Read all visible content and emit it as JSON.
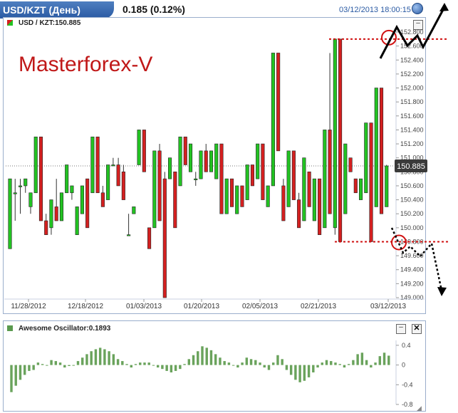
{
  "header": {
    "title": "USD/KZT (День)",
    "quote": "0.185 (0.12%)",
    "timestamp": "03/12/2013 18:00:15"
  },
  "main_panel": {
    "legend": "USD / KZT:150.885",
    "minimize_label": "–",
    "watermark": "Masterforex-V",
    "last_price_label": "150.885"
  },
  "oscillator_panel": {
    "legend": "Awesome Oscillator:0.1893",
    "minimize_label": "–",
    "close_label": "✕",
    "resize_icon": "resize-grip-icon"
  },
  "colors": {
    "up": "#22c322",
    "down": "#d42020",
    "oscillator": "#6aa35c",
    "annotation": "#d01010"
  },
  "chart_data": [
    {
      "type": "candlestick",
      "title": "USD / KZT",
      "ylim": [
        149.0,
        152.8
      ],
      "yticks": [
        149.0,
        149.2,
        149.4,
        149.6,
        149.8,
        150.0,
        150.2,
        150.4,
        150.6,
        150.8,
        151.0,
        151.2,
        151.4,
        151.6,
        151.8,
        152.0,
        152.2,
        152.4,
        152.6,
        152.8
      ],
      "ytick_labels": [
        "149.000",
        "149.200",
        "149.400",
        "149.600",
        "149.800",
        "150.000",
        "150.200",
        "150.400",
        "150.600",
        "150.800",
        "151.000",
        "151.200",
        "151.400",
        "151.600",
        "151.800",
        "152.000",
        "152.200",
        "152.400",
        "152.600",
        "152.800"
      ],
      "xtick_labels": [
        "11/28/2012",
        "12/18/2012",
        "01/03/2013",
        "01/20/2013",
        "02/05/2013",
        "02/21/2013",
        "03/12/2013"
      ],
      "last_value": 150.885,
      "annotations": {
        "resistance": 152.7,
        "support": 149.8
      },
      "candles": [
        {
          "o": 149.7,
          "h": 150.7,
          "l": 149.7,
          "c": 150.7
        },
        {
          "o": 150.5,
          "h": 150.7,
          "l": 150.1,
          "c": 150.5
        },
        {
          "o": 150.6,
          "h": 150.7,
          "l": 150.2,
          "c": 150.6
        },
        {
          "o": 150.6,
          "h": 150.7,
          "l": 150.5,
          "c": 150.7
        },
        {
          "o": 150.3,
          "h": 150.3,
          "l": 150.2,
          "c": 150.5
        },
        {
          "o": 150.5,
          "h": 151.3,
          "l": 150.5,
          "c": 151.3
        },
        {
          "o": 151.3,
          "h": 151.3,
          "l": 150.1,
          "c": 150.1
        },
        {
          "o": 150.1,
          "h": 150.2,
          "l": 149.9,
          "c": 149.9
        },
        {
          "o": 150.0,
          "h": 150.4,
          "l": 149.9,
          "c": 150.4
        },
        {
          "o": 150.3,
          "h": 150.7,
          "l": 150.1,
          "c": 150.1
        },
        {
          "o": 150.1,
          "h": 150.5,
          "l": 150.1,
          "c": 150.5
        },
        {
          "o": 150.5,
          "h": 150.9,
          "l": 150.5,
          "c": 150.9
        },
        {
          "o": 150.5,
          "h": 150.6,
          "l": 150.4,
          "c": 150.6
        },
        {
          "o": 149.9,
          "h": 150.3,
          "l": 149.9,
          "c": 150.3
        },
        {
          "o": 150.2,
          "h": 150.6,
          "l": 150.2,
          "c": 150.6
        },
        {
          "o": 150.7,
          "h": 150.7,
          "l": 150.0,
          "c": 150.0
        },
        {
          "o": 150.5,
          "h": 151.3,
          "l": 150.5,
          "c": 151.3
        },
        {
          "o": 151.3,
          "h": 151.3,
          "l": 150.5,
          "c": 150.5
        },
        {
          "o": 150.5,
          "h": 150.6,
          "l": 150.3,
          "c": 150.3
        },
        {
          "o": 150.4,
          "h": 150.9,
          "l": 150.4,
          "c": 150.9
        },
        {
          "o": 150.9,
          "h": 151.0,
          "l": 150.9,
          "c": 150.9
        },
        {
          "o": 150.9,
          "h": 151.0,
          "l": 150.6,
          "c": 150.6
        },
        {
          "o": 150.8,
          "h": 150.9,
          "l": 150.4,
          "c": 150.4
        },
        {
          "o": 149.9,
          "h": 150.2,
          "l": 149.9,
          "c": 149.9
        },
        {
          "o": 150.2,
          "h": 150.3,
          "l": 150.2,
          "c": 150.3
        },
        {
          "o": 150.9,
          "h": 151.4,
          "l": 150.9,
          "c": 151.4
        },
        {
          "o": 151.4,
          "h": 151.4,
          "l": 150.8,
          "c": 150.8
        },
        {
          "o": 150.0,
          "h": 150.0,
          "l": 149.7,
          "c": 149.7
        },
        {
          "o": 150.0,
          "h": 151.1,
          "l": 150.0,
          "c": 151.1
        },
        {
          "o": 151.1,
          "h": 151.2,
          "l": 150.1,
          "c": 150.1
        },
        {
          "o": 150.7,
          "h": 150.8,
          "l": 149.0,
          "c": 149.0
        },
        {
          "o": 150.7,
          "h": 151.0,
          "l": 150.7,
          "c": 151.0
        },
        {
          "o": 150.8,
          "h": 150.8,
          "l": 150.0,
          "c": 150.0
        },
        {
          "o": 150.6,
          "h": 151.3,
          "l": 150.6,
          "c": 151.3
        },
        {
          "o": 151.3,
          "h": 151.3,
          "l": 150.9,
          "c": 150.9
        },
        {
          "o": 150.8,
          "h": 151.2,
          "l": 150.8,
          "c": 151.2
        },
        {
          "o": 150.7,
          "h": 150.8,
          "l": 150.6,
          "c": 150.7
        },
        {
          "o": 150.7,
          "h": 151.1,
          "l": 150.7,
          "c": 151.1
        },
        {
          "o": 151.1,
          "h": 151.2,
          "l": 150.8,
          "c": 150.8
        },
        {
          "o": 150.8,
          "h": 151.1,
          "l": 150.8,
          "c": 151.1
        },
        {
          "o": 150.7,
          "h": 151.2,
          "l": 150.7,
          "c": 151.2
        },
        {
          "o": 151.2,
          "h": 151.2,
          "l": 150.2,
          "c": 150.2
        },
        {
          "o": 150.2,
          "h": 150.7,
          "l": 150.2,
          "c": 150.7
        },
        {
          "o": 150.7,
          "h": 150.7,
          "l": 150.3,
          "c": 150.3
        },
        {
          "o": 150.2,
          "h": 150.6,
          "l": 150.2,
          "c": 150.6
        },
        {
          "o": 150.6,
          "h": 150.6,
          "l": 150.3,
          "c": 150.3
        },
        {
          "o": 150.4,
          "h": 150.9,
          "l": 150.4,
          "c": 150.9
        },
        {
          "o": 150.9,
          "h": 150.9,
          "l": 150.6,
          "c": 150.6
        },
        {
          "o": 150.7,
          "h": 151.2,
          "l": 150.7,
          "c": 151.2
        },
        {
          "o": 151.2,
          "h": 151.2,
          "l": 150.4,
          "c": 150.4
        },
        {
          "o": 150.3,
          "h": 150.6,
          "l": 150.3,
          "c": 150.6
        },
        {
          "o": 150.6,
          "h": 152.5,
          "l": 150.6,
          "c": 152.5
        },
        {
          "o": 152.5,
          "h": 152.5,
          "l": 151.1,
          "c": 151.1
        },
        {
          "o": 150.6,
          "h": 150.7,
          "l": 150.1,
          "c": 150.1
        },
        {
          "o": 150.3,
          "h": 151.1,
          "l": 150.3,
          "c": 151.1
        },
        {
          "o": 151.1,
          "h": 151.1,
          "l": 150.4,
          "c": 150.4
        },
        {
          "o": 150.4,
          "h": 150.5,
          "l": 150.0,
          "c": 150.0
        },
        {
          "o": 150.1,
          "h": 151.0,
          "l": 150.1,
          "c": 151.0
        },
        {
          "o": 150.8,
          "h": 150.8,
          "l": 150.3,
          "c": 150.3
        },
        {
          "o": 150.1,
          "h": 150.7,
          "l": 150.1,
          "c": 150.7
        },
        {
          "o": 150.7,
          "h": 150.7,
          "l": 149.9,
          "c": 149.9
        },
        {
          "o": 150.0,
          "h": 151.4,
          "l": 150.0,
          "c": 151.4
        },
        {
          "o": 151.4,
          "h": 152.5,
          "l": 150.2,
          "c": 150.2
        },
        {
          "o": 150.0,
          "h": 152.7,
          "l": 149.9,
          "c": 152.7
        },
        {
          "o": 152.7,
          "h": 152.7,
          "l": 149.8,
          "c": 149.8
        },
        {
          "o": 150.2,
          "h": 151.2,
          "l": 150.2,
          "c": 151.2
        },
        {
          "o": 151.0,
          "h": 151.0,
          "l": 150.8,
          "c": 150.8
        },
        {
          "o": 150.7,
          "h": 150.7,
          "l": 150.5,
          "c": 150.5
        },
        {
          "o": 150.4,
          "h": 150.7,
          "l": 150.4,
          "c": 150.7
        },
        {
          "o": 150.5,
          "h": 151.5,
          "l": 150.5,
          "c": 151.5
        },
        {
          "o": 151.5,
          "h": 151.5,
          "l": 149.8,
          "c": 149.8
        },
        {
          "o": 150.3,
          "h": 152.0,
          "l": 150.3,
          "c": 152.0
        },
        {
          "o": 152.0,
          "h": 152.0,
          "l": 150.2,
          "c": 150.2
        },
        {
          "o": 150.3,
          "h": 150.9,
          "l": 150.3,
          "c": 150.885
        }
      ]
    },
    {
      "type": "bar",
      "title": "Awesome Oscillator",
      "last_value": 0.1893,
      "ylim": [
        -0.8,
        0.5
      ],
      "yticks": [
        0.4,
        0,
        -0.4,
        -0.8
      ],
      "ytick_labels": [
        "0.4",
        "0",
        "-0.4",
        "-0.8"
      ],
      "values": [
        -0.55,
        -0.42,
        -0.3,
        -0.2,
        -0.12,
        -0.1,
        0.05,
        0.02,
        0.0,
        0.1,
        0.08,
        0.05,
        -0.05,
        -0.02,
        0.0,
        0.08,
        0.15,
        0.22,
        0.28,
        0.32,
        0.35,
        0.32,
        0.28,
        0.22,
        0.12,
        0.08,
        0.02,
        -0.05,
        0.02,
        0.05,
        0.05,
        0.05,
        0.0,
        -0.05,
        -0.08,
        -0.12,
        -0.15,
        -0.12,
        -0.08,
        0.02,
        0.12,
        0.2,
        0.28,
        0.38,
        0.35,
        0.3,
        0.22,
        0.15,
        0.08,
        0.05,
        0.0,
        -0.05,
        0.05,
        0.15,
        0.12,
        0.1,
        0.05,
        -0.05,
        -0.1,
        0.05,
        0.2,
        0.12,
        -0.1,
        -0.2,
        -0.3,
        -0.35,
        -0.32,
        -0.25,
        -0.15,
        -0.05,
        0.05,
        0.1,
        0.08,
        0.05,
        0.02,
        -0.05,
        0.02,
        0.1,
        0.22,
        0.25,
        0.1,
        -0.05,
        0.05,
        0.18,
        0.25,
        0.19
      ]
    }
  ]
}
